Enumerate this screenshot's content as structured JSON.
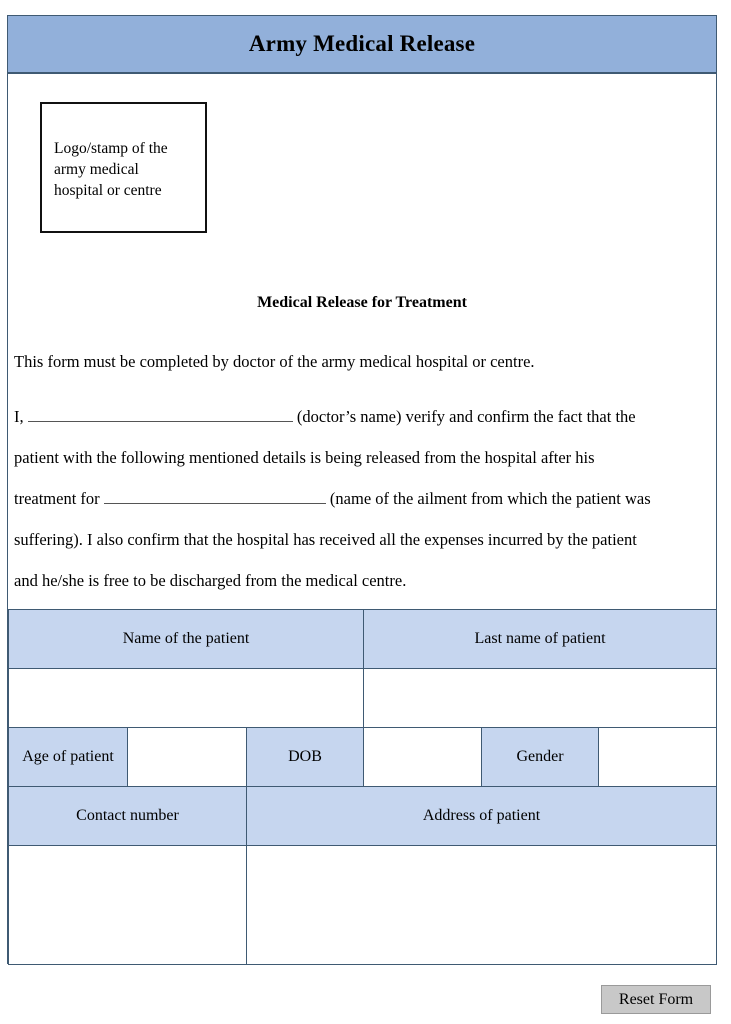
{
  "document": {
    "title": "Army Medical Release"
  },
  "logo_box": {
    "text": "Logo/stamp of the\narmy medical\nhospital or centre"
  },
  "section": {
    "heading": "Medical Release for Treatment"
  },
  "body": {
    "intro": "This form must be completed by doctor of the army medical hospital or centre.",
    "para1_before": "I,",
    "para1_after": "(doctor’s name) verify and confirm the fact that the",
    "para2": "patient with the following mentioned details is being released from the hospital after his",
    "para3_before": "treatment for",
    "para3_after": "(name of the ailment from which the patient was",
    "para4": "suffering). I also confirm that the hospital has received all the expenses incurred by the patient",
    "para5": "and he/she is free to be discharged from the medical centre."
  },
  "table": {
    "name_header": "Name of the patient",
    "lastname_header": "Last name of patient",
    "name_value": "",
    "lastname_value": "",
    "age_label": "Age of patient",
    "age_value": "",
    "dob_label": "DOB",
    "dob_value": "",
    "gender_label": "Gender",
    "gender_value": "",
    "contact_label": "Contact number",
    "address_label": "Address of patient",
    "contact_value": "",
    "address_value": ""
  },
  "actions": {
    "reset_label": "Reset Form"
  },
  "colors": {
    "title_band": "#92b0da",
    "table_header": "#c6d6ef",
    "border": "#3f5a73",
    "button_face": "#c8c8c8"
  }
}
